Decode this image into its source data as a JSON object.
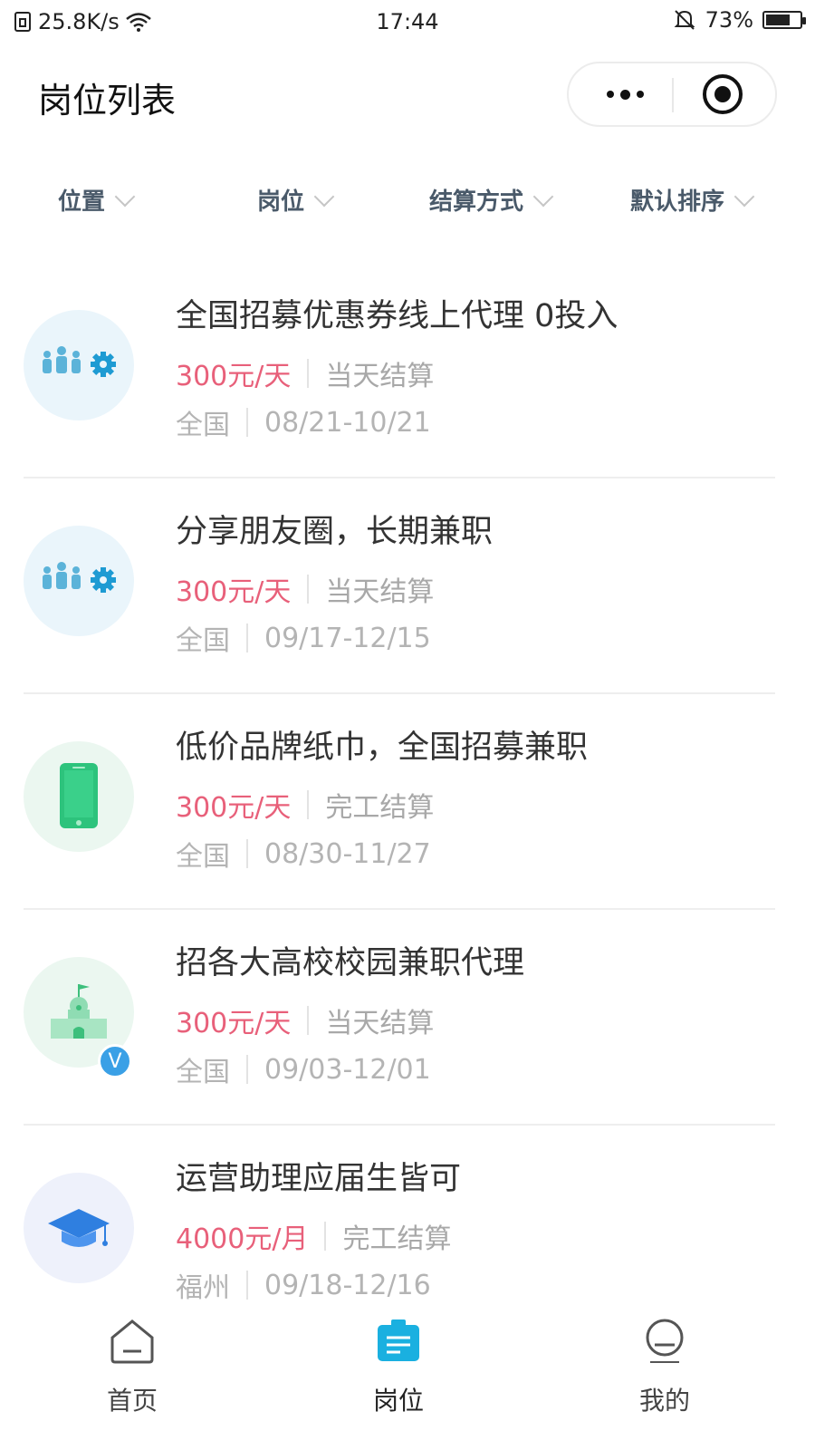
{
  "status_bar": {
    "network_speed": "25.8K/s",
    "time": "17:44",
    "battery_percent": "73%",
    "battery_level": 0.73,
    "icons": [
      "sim-icon",
      "wifi-icon",
      "mute-bell-icon",
      "battery-icon"
    ]
  },
  "header": {
    "title": "岗位列表",
    "capsule_icons": [
      "more-dots-icon",
      "close-target-icon"
    ]
  },
  "filters": [
    {
      "label": "位置"
    },
    {
      "label": "岗位"
    },
    {
      "label": "结算方式"
    },
    {
      "label": "默认排序"
    }
  ],
  "jobs": [
    {
      "title": "全国招募优惠券线上代理 0投入",
      "salary": "300元/天",
      "settlement": "当天结算",
      "location": "全国",
      "dates": "08/21-10/21",
      "icon": "team-gear-icon"
    },
    {
      "title": "分享朋友圈，长期兼职",
      "salary": "300元/天",
      "settlement": "当天结算",
      "location": "全国",
      "dates": "09/17-12/15",
      "icon": "team-gear-icon"
    },
    {
      "title": "低价品牌纸巾，全国招募兼职",
      "salary": "300元/天",
      "settlement": "完工结算",
      "location": "全国",
      "dates": "08/30-11/27",
      "icon": "smartphone-icon"
    },
    {
      "title": "招各大高校校园兼职代理",
      "salary": "300元/天",
      "settlement": "当天结算",
      "location": "全国",
      "dates": "09/03-12/01",
      "icon": "school-building-icon",
      "badge": "V"
    },
    {
      "title": "运营助理应届生皆可",
      "salary": "4000元/月",
      "settlement": "完工结算",
      "location": "福州",
      "dates": "09/18-12/16",
      "icon": "graduation-cap-icon"
    }
  ],
  "tabbar": {
    "items": [
      {
        "label": "首页",
        "icon": "home-icon"
      },
      {
        "label": "岗位",
        "icon": "job-badge-icon",
        "active": true
      },
      {
        "label": "我的",
        "icon": "profile-icon"
      }
    ]
  },
  "colors": {
    "salary": "#e8607a",
    "accent": "#1ab0e0",
    "green_icon": "#2dc37c",
    "badge_blue": "#3aa0e6"
  }
}
